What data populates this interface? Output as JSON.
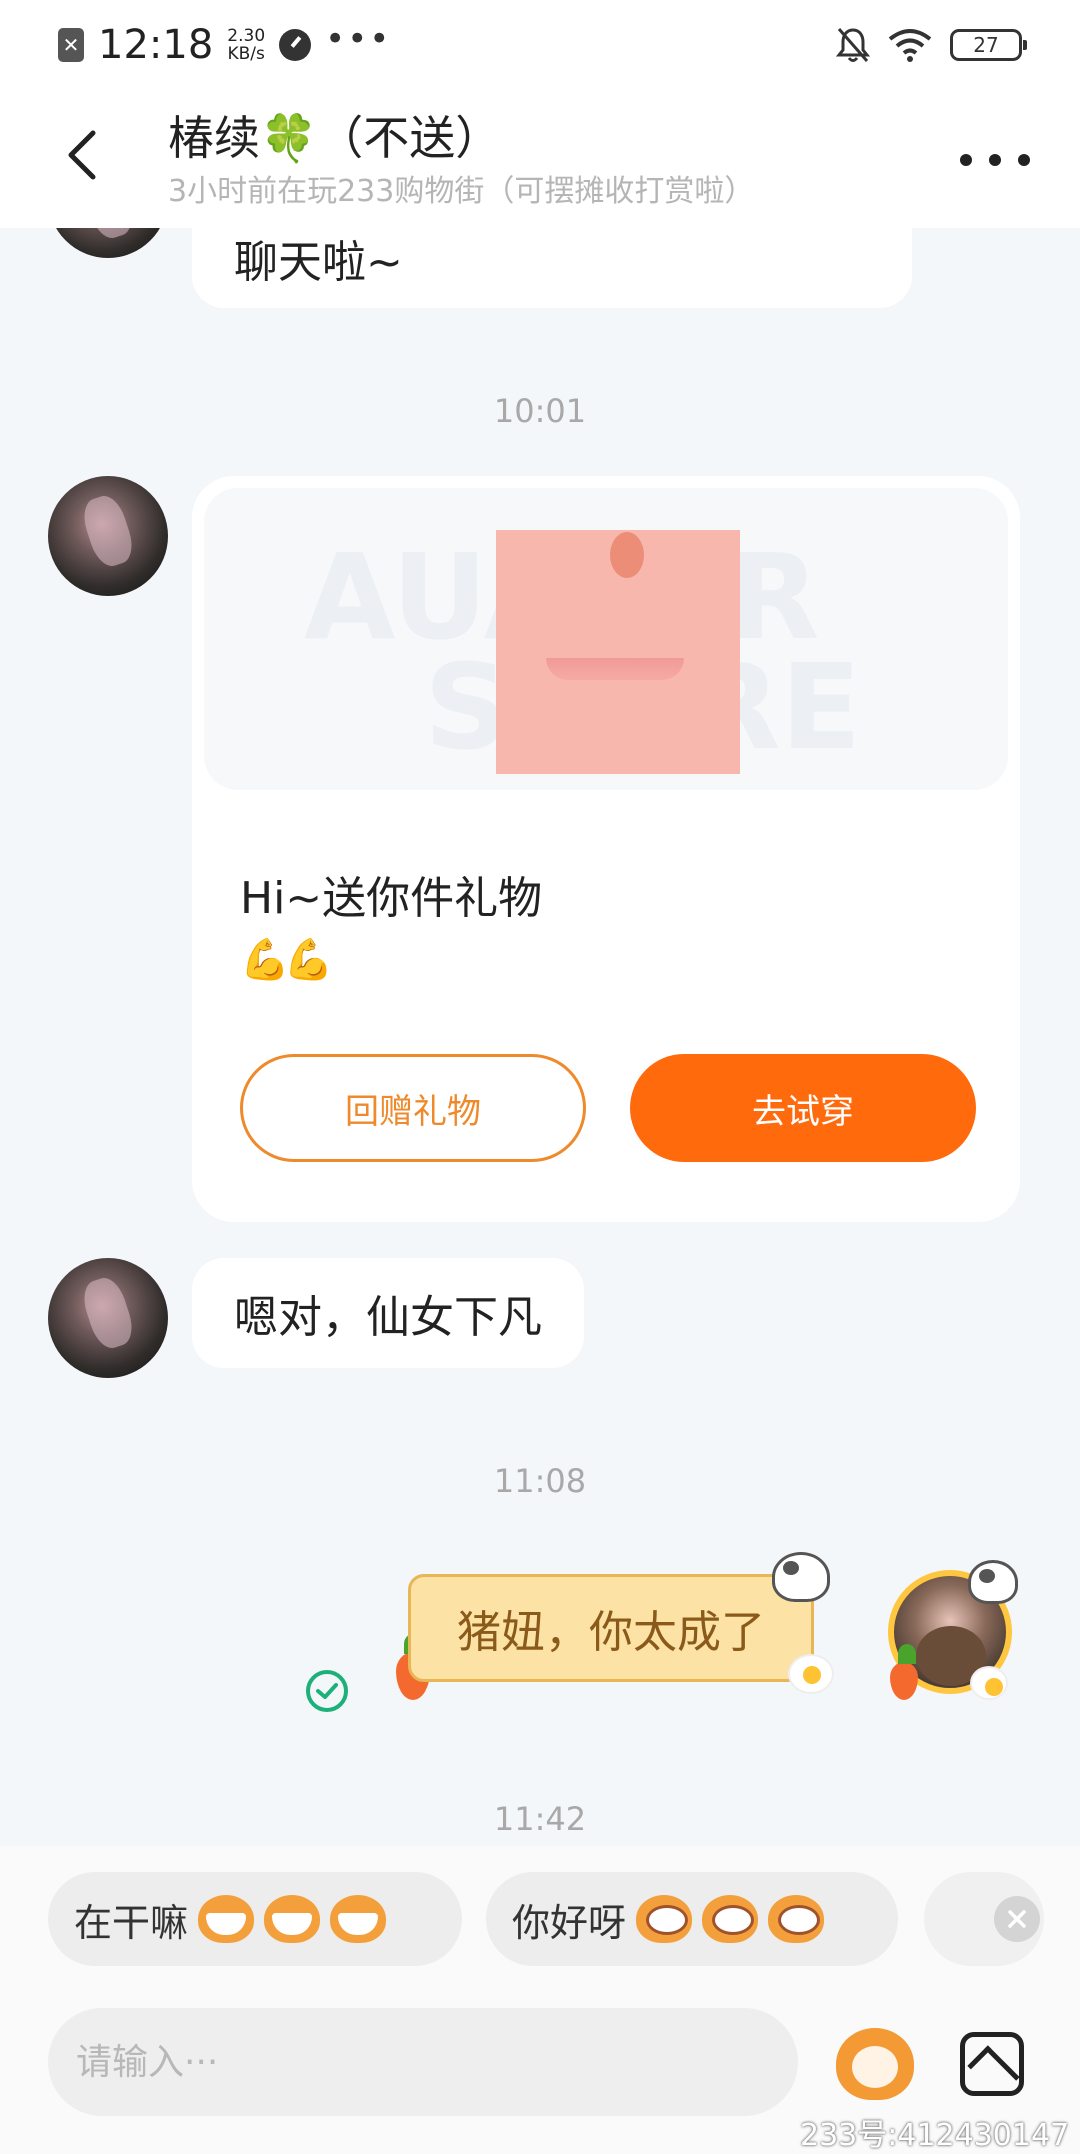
{
  "status_bar": {
    "time": "12:18",
    "speed_value": "2.30",
    "speed_unit": "KB/s",
    "battery": "27"
  },
  "header": {
    "title": "椿续🍀（不送）",
    "subtitle": "3小时前在玩233购物街（可摆摊收打赏啦）"
  },
  "messages": {
    "top_partial": "聊天啦~",
    "ts_1": "10:01",
    "gift_card": {
      "text": "Hi~送你件礼物",
      "emoji": "💪💪",
      "return_button": "回赠礼物",
      "try_button": "去试穿"
    },
    "reply_1": "嗯对，仙女下凡",
    "ts_2": "11:08",
    "my_message": "猪妞，你太成了",
    "ts_3": "11:42"
  },
  "quick_replies": [
    {
      "label": "在干嘛"
    },
    {
      "label": "你好呀"
    }
  ],
  "input": {
    "placeholder": "请输入···"
  },
  "watermark_id": "233号:412430147",
  "colors": {
    "accent_orange": "#ff6a0d",
    "sent_check_green": "#1cb07a",
    "bubble_yellow": "#fde2a5"
  },
  "icons": [
    "sim-icon",
    "back-icon",
    "more-icon",
    "check-icon",
    "emoji-mascot-icon",
    "image-icon",
    "close-icon",
    "wifi-icon",
    "bell-off-icon",
    "battery-icon"
  ]
}
